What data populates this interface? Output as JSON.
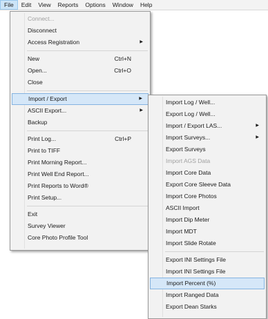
{
  "menubar": {
    "items": [
      "File",
      "Edit",
      "View",
      "Reports",
      "Options",
      "Window",
      "Help"
    ]
  },
  "file_menu": {
    "items": [
      {
        "label": "Connect...",
        "disabled": true
      },
      {
        "label": "Disconnect"
      },
      {
        "label": "Access Registration",
        "submenu": true
      },
      {
        "separator": true
      },
      {
        "label": "New",
        "shortcut": "Ctrl+N"
      },
      {
        "label": "Open...",
        "shortcut": "Ctrl+O"
      },
      {
        "label": "Close"
      },
      {
        "separator": true
      },
      {
        "label": "Import / Export",
        "submenu": true,
        "highlighted": true
      },
      {
        "label": "ASCII Export...",
        "submenu": true
      },
      {
        "label": "Backup"
      },
      {
        "separator": true
      },
      {
        "label": "Print Log...",
        "shortcut": "Ctrl+P"
      },
      {
        "label": "Print to TIFF"
      },
      {
        "label": "Print Morning Report..."
      },
      {
        "label": "Print Well End Report..."
      },
      {
        "label": "Print Reports to Word®"
      },
      {
        "label": "Print Setup..."
      },
      {
        "separator": true
      },
      {
        "label": "Exit"
      },
      {
        "label": "Survey Viewer"
      },
      {
        "label": "Core Photo Profile Tool"
      }
    ]
  },
  "import_export_menu": {
    "items": [
      {
        "label": "Import Log / Well..."
      },
      {
        "label": "Export Log / Well..."
      },
      {
        "label": "Import / Export LAS...",
        "submenu": true
      },
      {
        "label": "Import Surveys...",
        "submenu": true
      },
      {
        "label": "Export Surveys"
      },
      {
        "label": "Import AGS Data",
        "disabled": true
      },
      {
        "label": "Import Core Data"
      },
      {
        "label": "Export Core Sleeve Data"
      },
      {
        "label": "Import Core Photos"
      },
      {
        "label": "ASCII Import"
      },
      {
        "label": "Import Dip Meter"
      },
      {
        "label": "Import MDT"
      },
      {
        "label": "Import Slide Rotate"
      },
      {
        "separator": true
      },
      {
        "label": "Export INI Settings File"
      },
      {
        "label": "Import INI Settings File"
      },
      {
        "label": "Import Percent (%)",
        "highlighted": true
      },
      {
        "label": "Import Ranged Data"
      },
      {
        "label": "Export Dean Starks"
      }
    ]
  },
  "colors": {
    "menubar_bg": "#f3f3f3",
    "menu_bg": "#f2f2f2",
    "highlight_bg": "#d5e7f8",
    "highlight_border": "#84b3e1",
    "disabled_text": "#a0a0a0"
  }
}
